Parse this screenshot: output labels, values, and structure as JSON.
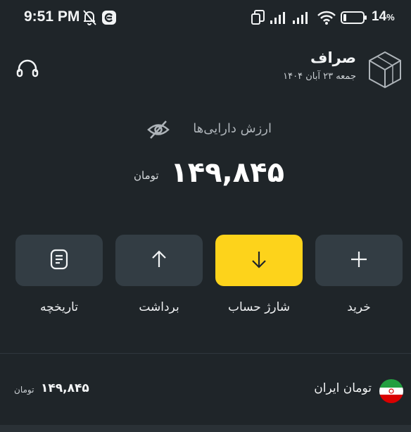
{
  "status_bar": {
    "time": "9:51 PM",
    "battery_percent": "14",
    "battery_sign": "%",
    "icons": [
      "mute-bell-icon",
      "app-notification-icon",
      "dual-screen-icon",
      "signal-icon",
      "signal-icon",
      "wifi-icon",
      "battery-icon"
    ]
  },
  "header": {
    "app_name": "صراف",
    "date": "جمعه ۲۳ آبان ۱۴۰۴",
    "support_icon": "headset-icon",
    "logo_icon": "cube-logo-icon"
  },
  "balance": {
    "label": "ارزش دارایی‌ها",
    "amount": "۱۴۹,۸۴۵",
    "unit": "تومان",
    "visibility_icon": "eye-off-icon"
  },
  "actions": [
    {
      "label": "خرید",
      "icon": "plus-icon"
    },
    {
      "label": "شارژ حساب",
      "icon": "arrow-down-icon"
    },
    {
      "label": "برداشت",
      "icon": "arrow-up-icon"
    },
    {
      "label": "تاریخچه",
      "icon": "document-icon"
    }
  ],
  "assets": [
    {
      "name": "تومان ایران",
      "value": "۱۴۹,۸۴۵",
      "unit": "تومان",
      "icon": "iran-flag-icon"
    }
  ],
  "colors": {
    "background": "#1f2529",
    "button": "#333d44",
    "accent": "#fdd31b",
    "text": "#f2f4f5",
    "muted": "#aeb4b9"
  }
}
